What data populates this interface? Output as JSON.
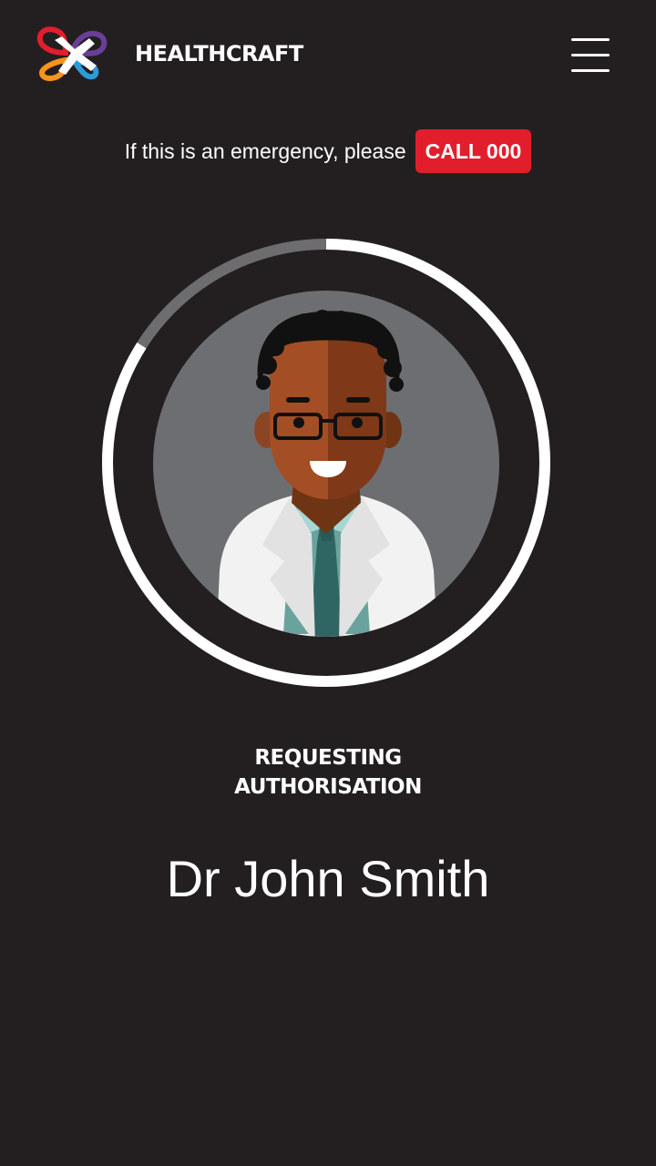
{
  "header": {
    "brand": "HEALTHCRAFT",
    "logo_icon": "healthcraft-logo-icon",
    "menu_icon": "hamburger-menu-icon"
  },
  "emergency": {
    "text": "If this is an emergency, please",
    "call_label": "CALL 000",
    "call_color": "#e21e2c"
  },
  "status": {
    "line1": "REQUESTING",
    "line2": "AUTHORISATION"
  },
  "doctor": {
    "name": "Dr John Smith",
    "avatar_icon": "doctor-avatar-icon"
  },
  "progress": {
    "fraction": 0.84
  },
  "colors": {
    "background": "#231f20",
    "ring_track": "#6d6d6f",
    "ring_fill": "#ffffff",
    "avatar_bg": "#6d6e71"
  }
}
